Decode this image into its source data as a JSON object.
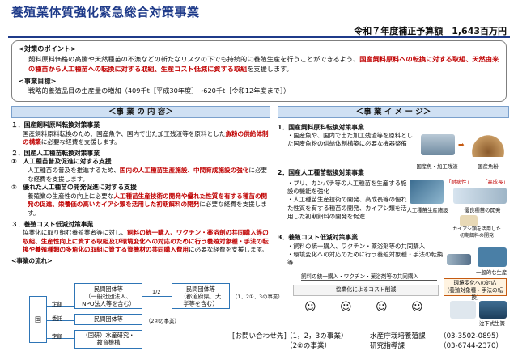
{
  "title": "養殖業体質強化緊急総合対策事業",
  "budget": "令和７年度補正予算額　1,643百万円",
  "points": {
    "heading": "<対策のポイント>",
    "text_a": "飼料原料価格の高騰や天然種苗の不漁などの新たなリスクの下でも持続的に養殖生産を行うことができるよう、",
    "text_red": "国産飼料原料への転換に対する取組、天然由来の種苗から人工種苗への転換に対する取組、生産コスト低減に資する取組",
    "text_b": "を支援します。",
    "goal_heading": "<事業目標>",
    "goal_text": "戦略的養殖品目の生産量の増加（409千t［平成30年度］→620千t［令和12年度まで］）"
  },
  "left": {
    "header": "＜事 業 の 内 容＞",
    "s1_title": "１．国産飼料原料転換対策事業",
    "s1_body_a": "国産飼料原料転換のため、国産魚や、国内で出た加工残渣等を原料とした",
    "s1_body_red": "魚粉の供給体制の構築",
    "s1_body_b": "に必要な経費を支援します。",
    "s2_title": "２．国産人工種苗転換対策事業",
    "s2_1_title": "①　人工種苗普及促進に対する支援",
    "s2_1_body_a": "人工種苗の普及を推進するため、",
    "s2_1_body_red": "国内の人工種苗生産施設、中間育成施設の強化",
    "s2_1_body_b": "に必要な経費を支援します。",
    "s2_2_title": "②　優れた人工種苗の開発促進に対する支援",
    "s2_2_body_a": "養殖業の生産性の向上に必要な",
    "s2_2_body_red": "人工種苗生産技術の開発や優れた性質を有する種苗の開発の促進、栄養価の高いカイアシ類を活用した初期餌料の開発",
    "s2_2_body_b": "に必要な経費を支援します。",
    "s3_title": "３．養殖コスト低減対策事業",
    "s3_body_a": "協業化に取り組む養殖業者等に対し、",
    "s3_body_red": "飼料の統一購入、ワクチン・薬浴剤の共同購入等の取組、生産性向上に資する取組及び環境変化への対応のために行う養殖対象種・手法の転換や養殖種類の多角化の取組に資する資機材の共同購入費用",
    "s3_body_b": "に必要な経費を支援します。",
    "flow_title": "<事業の流れ>",
    "flow": {
      "gov": "国",
      "teigaku1": "定額",
      "itaku": "委託",
      "teigaku2": "定額",
      "box1": "民間団体等\n（一般社団法人、\nNPO法人等を含む）",
      "ratio": "1/2",
      "box2": "民間団体等\n（都道府県、大\n学等を含む）",
      "box2_note": "（1、2①、3の事業）",
      "box3": "民間団体等",
      "box3_note": "（2②の事業）",
      "box4": "（国研）水産研究・\n教育機構"
    }
  },
  "right": {
    "header": "＜事 業 イ メ ー ジ＞",
    "s1_title": "1．国産飼料原料転換対策事業",
    "s1_bullet": "・国産魚や、国内で出た加工残渣等を原料とした国産魚粉の供給体制構築に必要な機器整備",
    "s1_cap1": "国産魚・加工残渣",
    "s1_cap2": "国産魚粉",
    "s2_title": "2．国産人工種苗転換対策事業",
    "s2_b1": "・ブリ、カンパチ等の人工種苗を生産する施設の機能を強化",
    "s2_b2": "・人工種苗生産技術の開発、高成長等の優れた性質を有する種苗の開発、カイアシ類を活用した初期餌料の開発を促進",
    "s2_label1": "「耐病性」",
    "s2_label2": "「高成長」",
    "s2_cap1": "人工種苗生産施設",
    "s2_cap2": "優良種苗の開発",
    "s2_cap3": "カイアシ類を活用した\n初期餌料の開発",
    "s3_title": "3．養殖コスト低減対策事業",
    "s3_b1": "・飼料の統一購入、ワクチン・薬浴剤等の共同購入",
    "s3_b2": "・環境変化への対応のために行う養殖対象種・手法の転換等",
    "s3_flow_label": "飼料の統一購入・ワクチン・薬浴剤等の共同購入",
    "s3_group": "協業化によるコスト削減",
    "s3_right_label": "一般的な生産",
    "s3_env": "環境変化への対応\n(養殖対象種・手法の転換)",
    "s3_cap": "沈下式生簀"
  },
  "contact": {
    "label": "[お問い合わせ先]",
    "scope1": "（1，2，3の事業）",
    "scope2": "（2②の事業）",
    "dept1": "水産庁栽培養殖課",
    "dept2": "研究指導課",
    "tel1": "（03-3502-0895）",
    "tel2": "（03-6744-2370）"
  },
  "colors": {
    "title": "#1f3b8a",
    "highlight": "#c00000",
    "header_bg": "#cfe0f3"
  }
}
